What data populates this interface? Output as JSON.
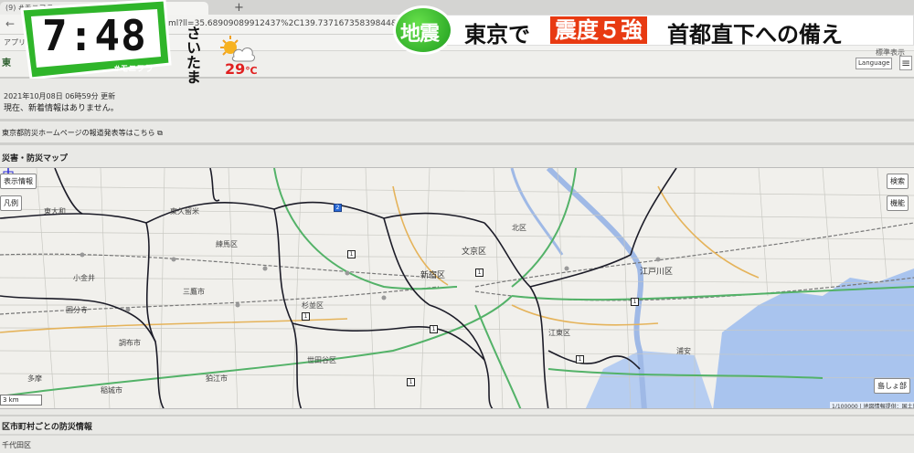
{
  "browser": {
    "tab_title": "(9) #モニフラ",
    "new_tab": "+",
    "url": "ml?ll=35.68909089912437%2C139.73716735839844&z=12&l=35",
    "bookmarks_apps": "アプリ"
  },
  "broadcast": {
    "clock": "7:48",
    "hashtag": "#モニフラ",
    "weather_city": "さいたま",
    "temperature": "29",
    "temperature_unit": "℃",
    "badge": "地震",
    "headline_part1": "東京で",
    "headline_highlight": "震度５強",
    "headline_part2": "首都直下への備え",
    "badge_color": "#2aa52a",
    "highlight_color": "#e83a12"
  },
  "site": {
    "logo_partial": "東",
    "language_button": "Language",
    "display_link": "標準表示",
    "update_time": "2021年10月08日 06時59分 更新",
    "no_news": "現在、新着情報はありません。",
    "official_link": "東京都防災ホームページの報道発表等はこちら",
    "map_section_title": "災害・防災マップ",
    "municipal_title": "区市町村ごとの防災情報",
    "ward": "千代田区"
  },
  "map": {
    "btn_display_info": "表示情報",
    "btn_legend": "凡例",
    "btn_search": "検索",
    "btn_function": "機能",
    "btn_islands": "島しょ部",
    "scale": "3 km",
    "attribution": "1/100000 | 地図情報提供：国土地",
    "places": {
      "shinjuku": "新宿区",
      "bunkyo": "文京区",
      "edogawa": "江戸川区",
      "nerima": "練馬区",
      "suginami": "杉並区",
      "mitaka": "三鷹市",
      "chofu": "調布市",
      "setagaya": "世田谷区",
      "kokubunji": "国分寺",
      "kita": "北区",
      "tama": "多摩",
      "komae": "狛江市",
      "inagi": "稲城市",
      "koganei": "小金井",
      "higashiyamato": "東大和",
      "koto": "江東区",
      "urayasu": "浦安",
      "higashikurume": "東久留米"
    },
    "routes": [
      "1",
      "1",
      "1",
      "1",
      "1",
      "2",
      "1",
      "1"
    ]
  }
}
